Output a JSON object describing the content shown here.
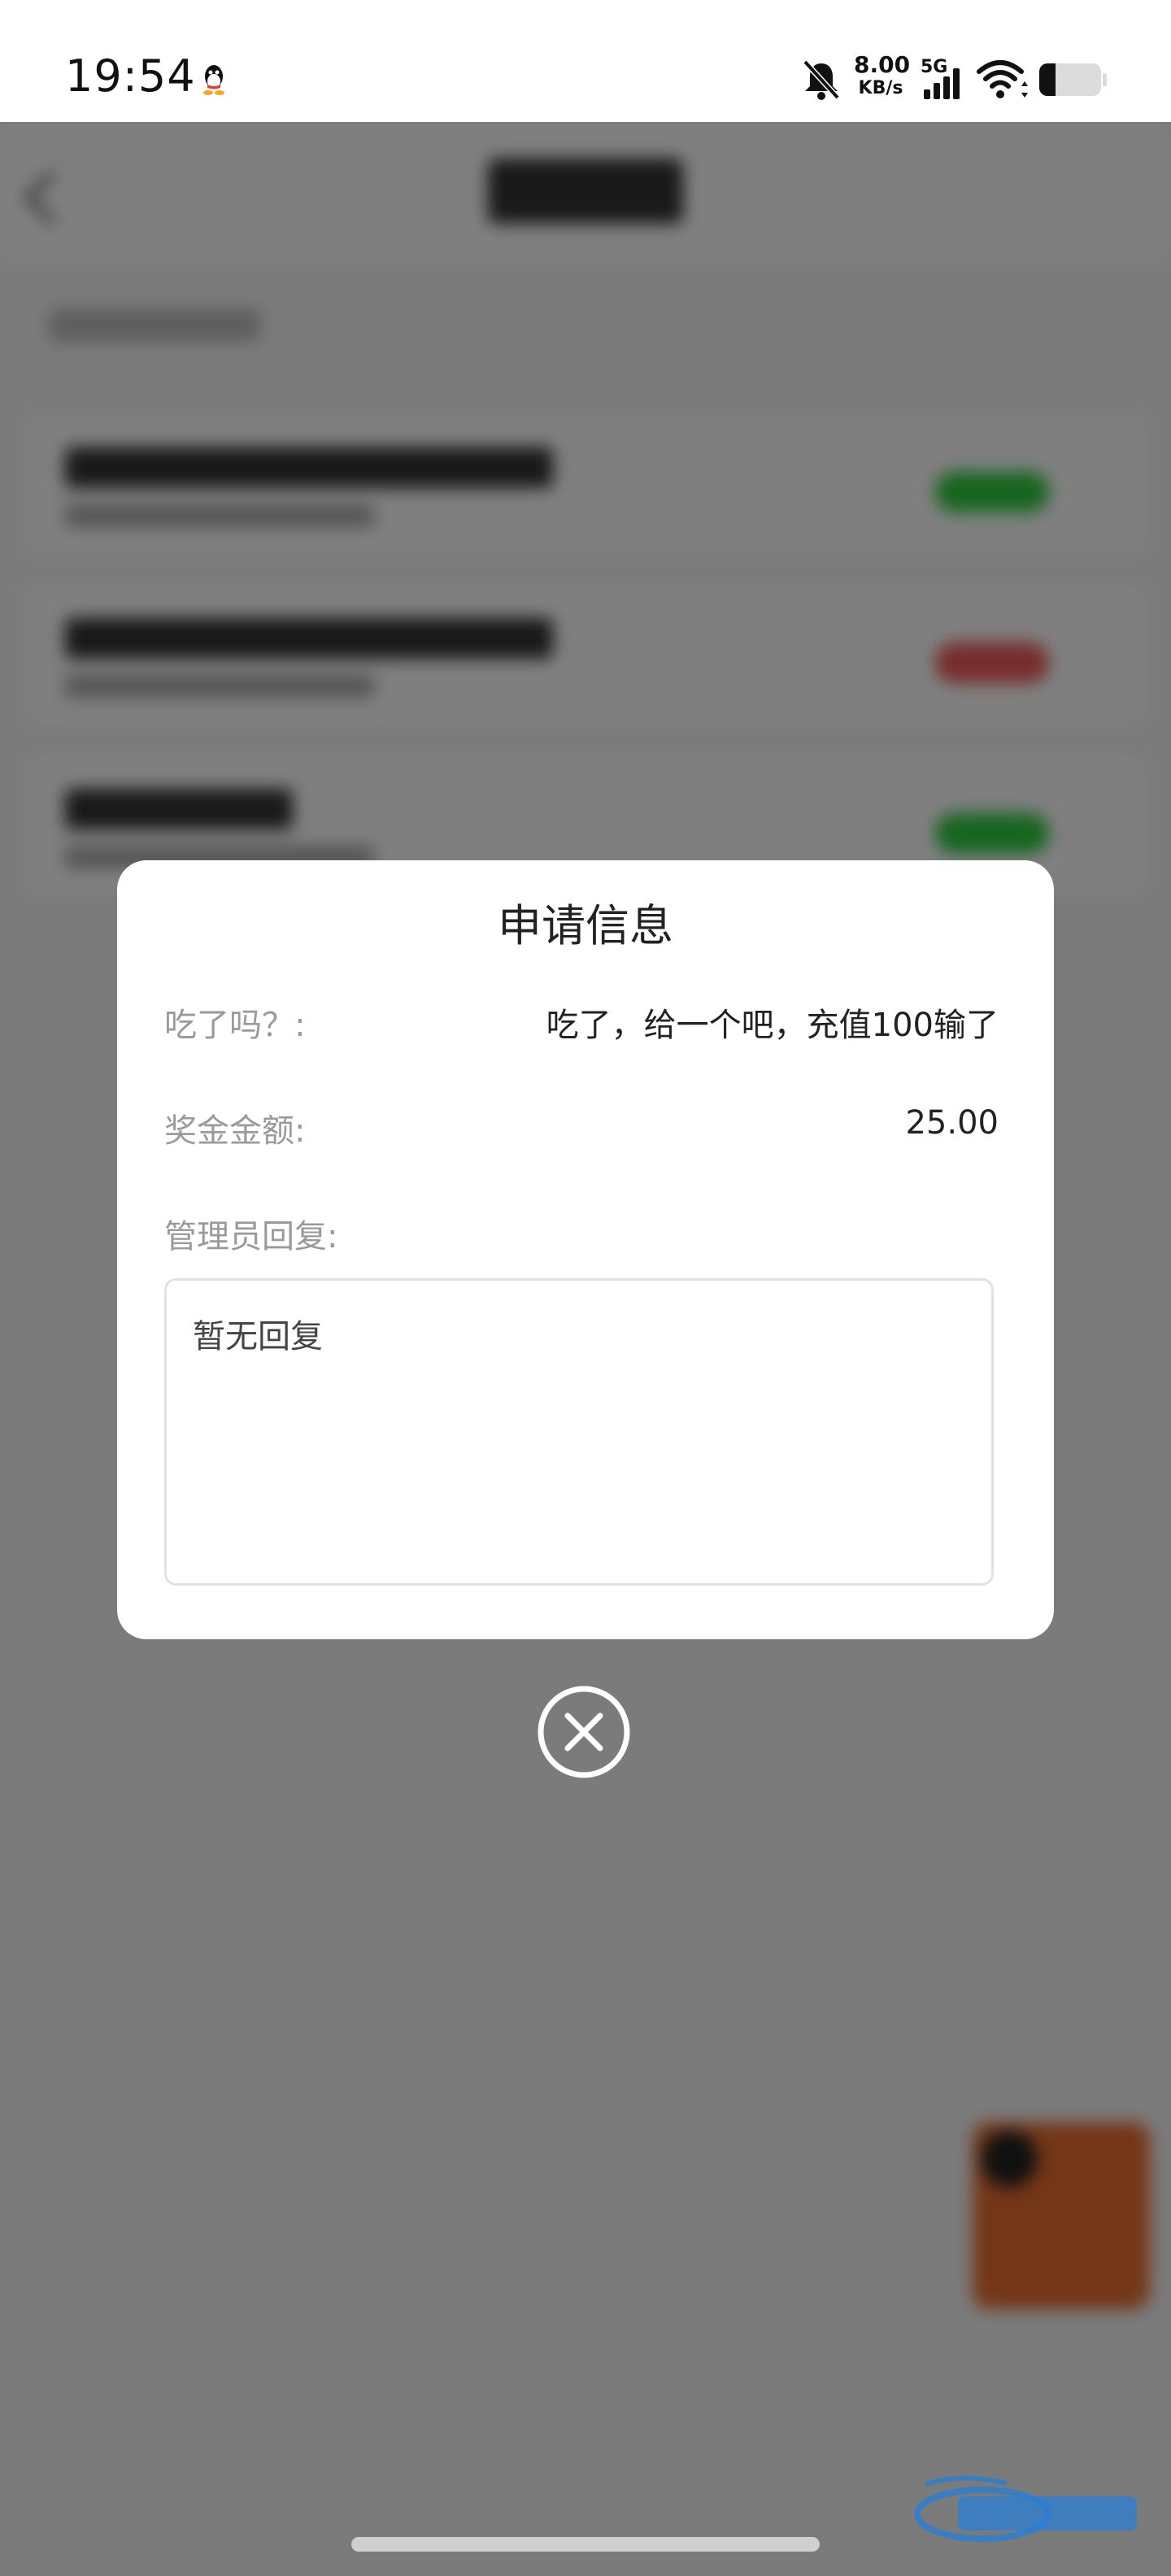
{
  "status_bar": {
    "time": "19:54",
    "net_speed_value": "8.00",
    "net_speed_unit": "KB/s",
    "network_type": "5G",
    "icons": [
      "qq-icon",
      "bell-off-icon",
      "signal-icon",
      "wifi-icon",
      "battery-icon"
    ]
  },
  "dialog": {
    "title": "申请信息",
    "rows": [
      {
        "label": "吃了吗？:",
        "value": "吃了，给一个吧，充值100输了"
      },
      {
        "label": "奖金金额:",
        "value": "25.00"
      }
    ],
    "reply_label": "管理员回复:",
    "reply_text": "暂无回复"
  },
  "close_icon": "close-circle-icon",
  "colors": {
    "overlay": "rgba(0,0,0,0.5)",
    "dialog_bg": "#ffffff",
    "label": "#9a9a9a",
    "value": "#222222",
    "border": "#e2e2e2"
  }
}
